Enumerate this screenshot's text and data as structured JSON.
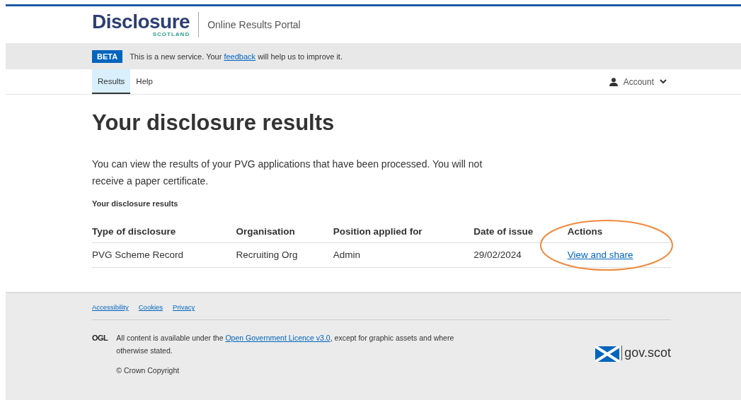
{
  "header": {
    "logo": {
      "word": "Disclosure",
      "sub": "SCOTLAND"
    },
    "service_name": "Online Results Portal"
  },
  "phase_banner": {
    "tag": "BETA",
    "text_before": "This is a new service. Your ",
    "link": "feedback",
    "text_after": " will help us to improve it."
  },
  "nav": {
    "tabs": [
      {
        "label": "Results",
        "selected": true
      },
      {
        "label": "Help",
        "selected": false
      }
    ],
    "account": "Account"
  },
  "main": {
    "title": "Your disclosure results",
    "intro": "You can view the results of your PVG applications that have been processed. You will not receive a paper certificate.",
    "table": {
      "caption": "Your disclosure results",
      "columns": [
        "Type of disclosure",
        "Organisation",
        "Position applied for",
        "Date of issue",
        "Actions"
      ],
      "rows": [
        {
          "type": "PVG Scheme Record",
          "organisation": "Recruiting Org",
          "position": "Admin",
          "date": "29/02/2024",
          "action": "View and share"
        }
      ]
    }
  },
  "footer": {
    "links": [
      "Accessibility",
      "Cookies",
      "Privacy"
    ],
    "ogl": "OGL",
    "licence_before": "All content is available under the ",
    "licence_link": "Open Government Licence v3.0",
    "licence_after": ", except for graphic assets and where otherwise stated.",
    "copyright": "© Crown Copyright",
    "gov_logo": "gov.scot"
  }
}
